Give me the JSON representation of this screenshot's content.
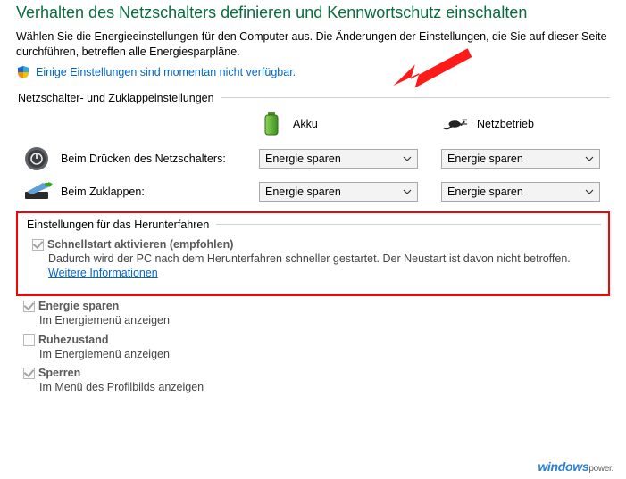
{
  "title": "Verhalten des Netzschalters definieren und Kennwortschutz einschalten",
  "intro": "Wählen Sie die Energieeinstellungen für den Computer aus. Die Änderungen der Einstellungen, die Sie auf dieser Seite durchführen, betreffen alle Energiesparpläne.",
  "shield_link": "Einige Einstellungen sind momentan nicht verfügbar.",
  "section1_label": "Netzschalter- und Zuklappeinstellungen",
  "mode": {
    "battery": "Akku",
    "plugged": "Netzbetrieb"
  },
  "rows": {
    "power": {
      "label": "Beim Drücken des Netzschalters:",
      "battery": "Energie sparen",
      "plugged": "Energie sparen"
    },
    "lid": {
      "label": "Beim Zuklappen:",
      "battery": "Energie sparen",
      "plugged": "Energie sparen"
    }
  },
  "section2_label": "Einstellungen für das Herunterfahren",
  "shutdown": {
    "fast": {
      "label": "Schnellstart aktivieren (empfohlen)",
      "desc_pre": "Dadurch wird der PC nach dem Herunterfahren schneller gestartet. Der Neustart ist davon nicht betroffen. ",
      "more": "Weitere Informationen",
      "checked": true
    },
    "sleep": {
      "label": "Energie sparen",
      "desc": "Im Energiemenü anzeigen",
      "checked": true
    },
    "hibernate": {
      "label": "Ruhezustand",
      "desc": "Im Energiemenü anzeigen",
      "checked": false
    },
    "lock": {
      "label": "Sperren",
      "desc": "Im Menü des Profilbilds anzeigen",
      "checked": true
    }
  },
  "watermark": {
    "w1": "windows",
    "w2": "power."
  }
}
